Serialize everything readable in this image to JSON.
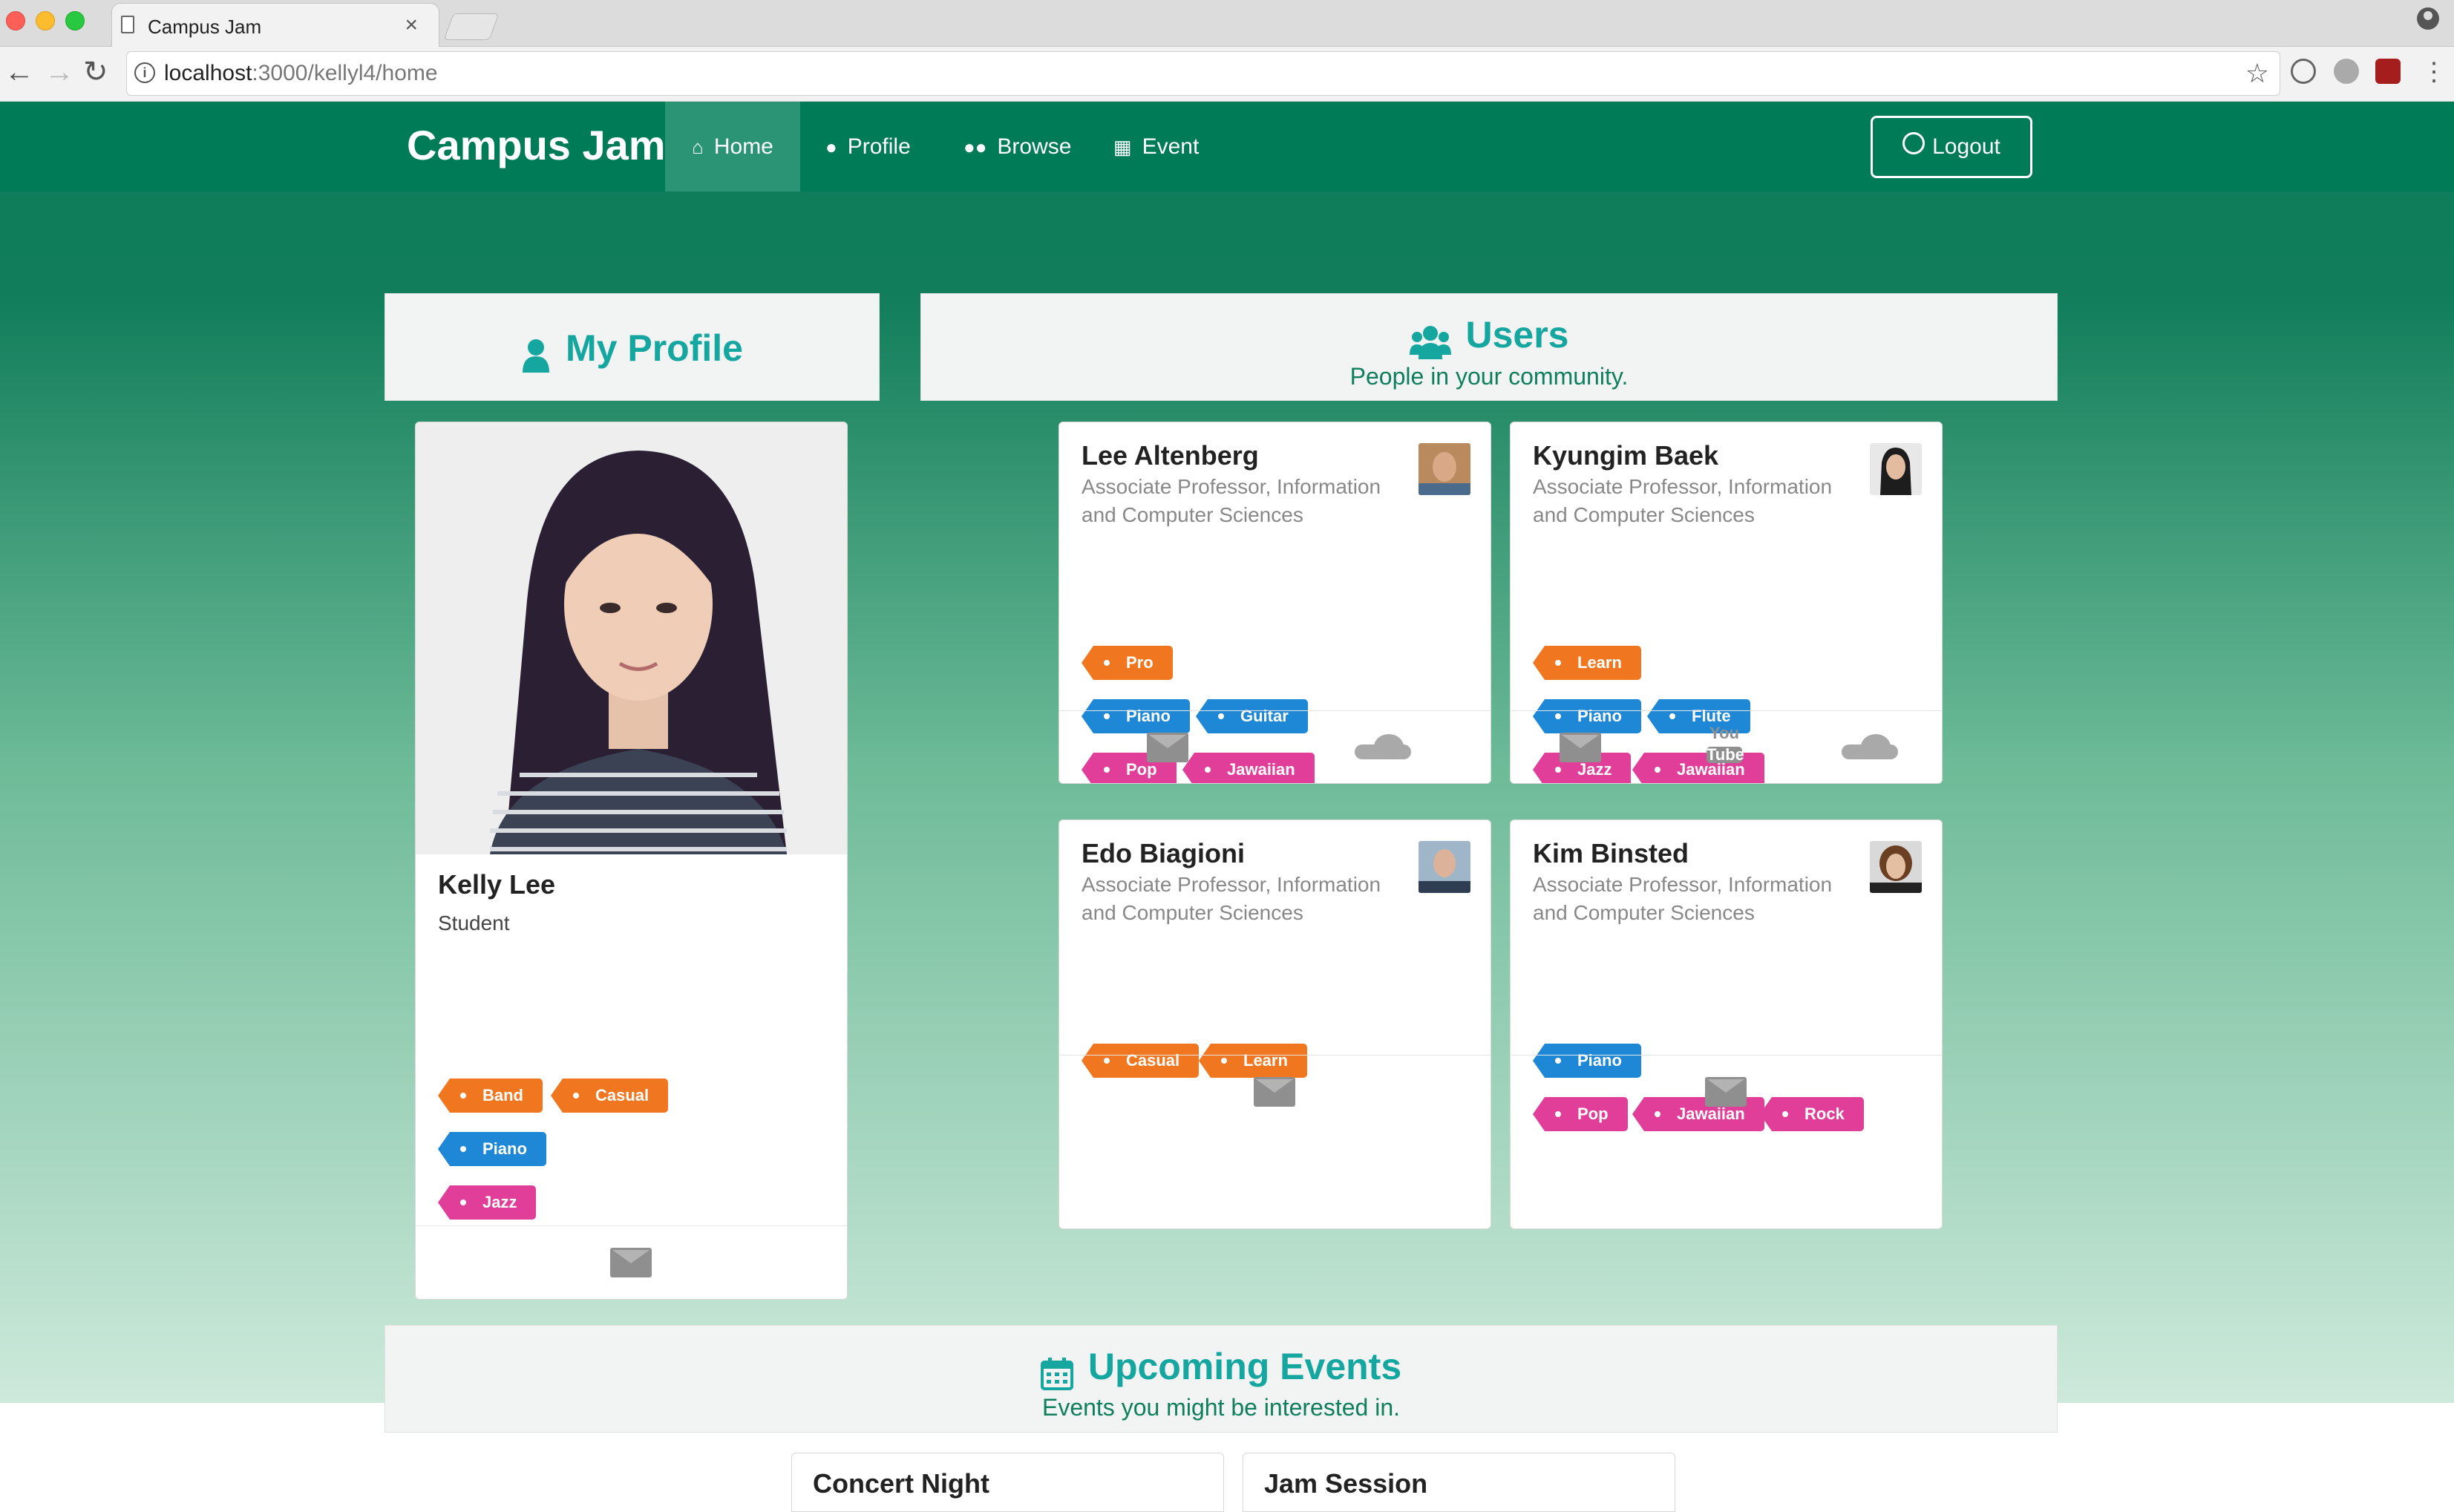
{
  "browser": {
    "tab_title": "Campus Jam",
    "url_host": "localhost",
    "url_path": ":3000/kellyl4/home"
  },
  "nav": {
    "brand": "Campus Jam",
    "items": [
      {
        "label": "Home",
        "icon": "home-icon",
        "active": true
      },
      {
        "label": "Profile",
        "icon": "user-icon"
      },
      {
        "label": "Browse",
        "icon": "users-icon"
      },
      {
        "label": "Event",
        "icon": "calendar-icon"
      }
    ],
    "logout_label": "Logout"
  },
  "my_profile": {
    "header": "My Profile",
    "name": "Kelly Lee",
    "role": "Student",
    "tags": [
      {
        "label": "Band",
        "color": "#f0771f"
      },
      {
        "label": "Casual",
        "color": "#f0771f"
      },
      {
        "label": "Piano",
        "color": "#1e87d6"
      },
      {
        "label": "Jazz",
        "color": "#e03e98"
      }
    ]
  },
  "users": {
    "header": "Users",
    "subheader": "People in your community.",
    "cards": [
      {
        "name": "Lee Altenberg",
        "role_line1": "Associate Professor, Information",
        "role_line2": "and Computer Sciences",
        "tags": [
          "Pro",
          "Piano",
          "Guitar",
          "Pop",
          "Jawaiian"
        ]
      },
      {
        "name": "Kyungim Baek",
        "role_line1": "Associate Professor, Information",
        "role_line2": "and Computer Sciences",
        "tags": [
          "Learn",
          "Piano",
          "Flute",
          "Jazz",
          "Jawaiian"
        ],
        "youtube_label_1": "You",
        "youtube_label_2": "Tube"
      },
      {
        "name": "Edo Biagioni",
        "role_line1": "Associate Professor, Information",
        "role_line2": "and Computer Sciences",
        "tags": [
          "Casual",
          "Learn"
        ]
      },
      {
        "name": "Kim Binsted",
        "role_line1": "Associate Professor, Information",
        "role_line2": "and Computer Sciences",
        "tags": [
          "Piano",
          "Pop",
          "Jawaiian",
          "Rock"
        ]
      }
    ]
  },
  "events": {
    "header": "Upcoming Events",
    "subheader": "Events you might be interested in.",
    "cards": [
      {
        "name": "Concert Night"
      },
      {
        "name": "Jam Session"
      }
    ]
  },
  "colors": {
    "nav_bg": "#007b58",
    "accent_teal": "#16a6a0",
    "tag_orange": "#f0771f",
    "tag_blue": "#1e87d6",
    "tag_pink": "#e03e98"
  }
}
